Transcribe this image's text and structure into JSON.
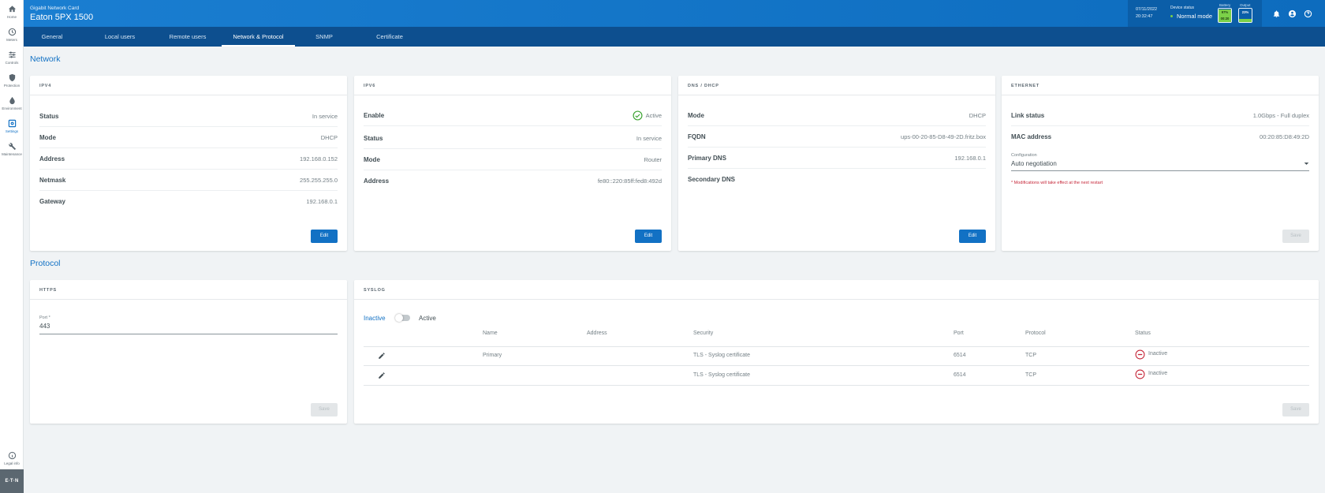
{
  "sidebar": {
    "items": [
      {
        "label": "Home",
        "icon": "home-icon"
      },
      {
        "label": "Meters",
        "icon": "meter-icon"
      },
      {
        "label": "Controls",
        "icon": "sliders-icon"
      },
      {
        "label": "Protection",
        "icon": "shield-icon"
      },
      {
        "label": "Environment",
        "icon": "droplet-icon"
      },
      {
        "label": "Settings",
        "icon": "gear-icon"
      },
      {
        "label": "Maintenance",
        "icon": "wrench-icon"
      }
    ],
    "legal": "Legal info",
    "brand": "E·T·N"
  },
  "header": {
    "subtitle": "Gigabit Network Card",
    "title": "Eaton 5PX 1500",
    "date": "07/11/2022",
    "time": "20:32:47",
    "device_status_label": "Device status",
    "device_status": "Normal mode",
    "battery_label": "Battery",
    "battery_pct": "97%",
    "battery_time": "00:20",
    "battery_level": 0.97,
    "output_label": "Output",
    "output_pct": "23%",
    "output_level": 0.23
  },
  "tabs": [
    "General",
    "Local users",
    "Remote users",
    "Network & Protocol",
    "SNMP",
    "Certificate"
  ],
  "network": {
    "title": "Network",
    "ipv4": {
      "title": "IPV4",
      "rows": [
        {
          "k": "Status",
          "v": "In service"
        },
        {
          "k": "Mode",
          "v": "DHCP"
        },
        {
          "k": "Address",
          "v": "192.168.0.152"
        },
        {
          "k": "Netmask",
          "v": "255.255.255.0"
        },
        {
          "k": "Gateway",
          "v": "192.168.0.1"
        }
      ],
      "button": "Edit"
    },
    "ipv6": {
      "title": "IPV6",
      "rows": [
        {
          "k": "Enable",
          "v": "Active"
        },
        {
          "k": "Status",
          "v": "In service"
        },
        {
          "k": "Mode",
          "v": "Router"
        },
        {
          "k": "Address",
          "v": "fe80::220:85ff:fed8:492d"
        }
      ],
      "button": "Edit"
    },
    "dns": {
      "title": "DNS / DHCP",
      "rows": [
        {
          "k": "Mode",
          "v": "DHCP"
        },
        {
          "k": "FQDN",
          "v": "ups-00-20-85-D8-49-2D.fritz.box"
        },
        {
          "k": "Primary DNS",
          "v": "192.168.0.1"
        },
        {
          "k": "Secondary DNS",
          "v": ""
        }
      ],
      "button": "Edit"
    },
    "ethernet": {
      "title": "ETHERNET",
      "rows": [
        {
          "k": "Link status",
          "v": "1.0Gbps - Full duplex"
        },
        {
          "k": "MAC address",
          "v": "00:20:85:D8:49:2D"
        }
      ],
      "config_label": "Configuration",
      "config_value": "Auto negotiation",
      "hint": "* Modifications will take effect at the next restart",
      "button": "Save"
    }
  },
  "protocol": {
    "title": "Protocol",
    "https": {
      "title": "HTTPS",
      "port_label": "Port *",
      "port_value": "443",
      "button": "Save"
    },
    "syslog": {
      "title": "SYSLOG",
      "toggle_off": "Inactive",
      "toggle_on": "Active",
      "columns": [
        "Name",
        "Address",
        "Security",
        "Port",
        "Protocol",
        "Status"
      ],
      "rows": [
        {
          "name": "Primary",
          "address": "",
          "security": "TLS - Syslog certificate",
          "port": "6514",
          "protocol": "TCP",
          "status": "Inactive"
        },
        {
          "name": "",
          "address": "",
          "security": "TLS - Syslog certificate",
          "port": "6514",
          "protocol": "TCP",
          "status": "Inactive"
        }
      ],
      "button": "Save"
    }
  }
}
